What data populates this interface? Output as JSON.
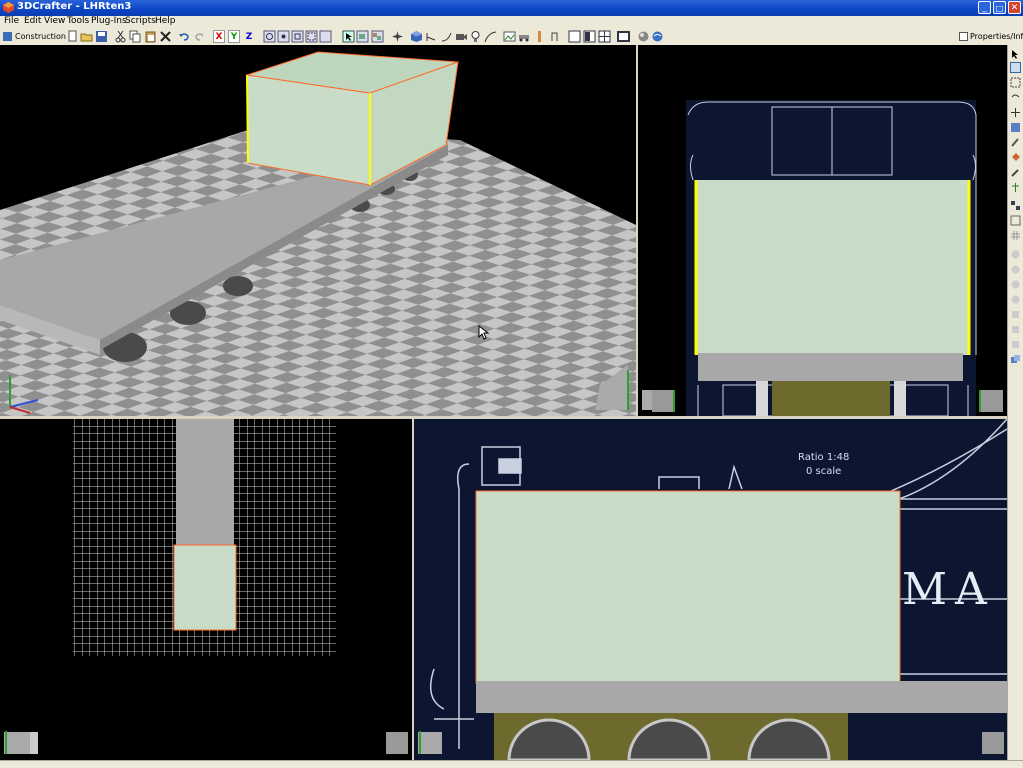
{
  "window": {
    "title": "3DCrafter - LHRten3",
    "minimize": "_",
    "maximize": "□",
    "close": "✕"
  },
  "menu": {
    "items": [
      "File",
      "Edit",
      "View",
      "Tools",
      "Plug-Ins",
      "Scripts",
      "Help"
    ]
  },
  "toolbar": {
    "construction_label": "Construction",
    "x_label": "X",
    "y_label": "Y",
    "z_label": "Z",
    "properties_label": "Properties/Info",
    "icons": [
      "new-icon",
      "open-icon",
      "save-icon",
      "cut-icon",
      "copy-icon",
      "paste-icon",
      "delete-icon",
      "undo-icon",
      "redo-icon"
    ]
  },
  "viewports": {
    "perspective": {
      "name": "perspective-view"
    },
    "front": {
      "name": "front-view"
    },
    "top": {
      "name": "top-view"
    },
    "side": {
      "name": "side-view",
      "ratio_line1": "Ratio 1:48",
      "ratio_line2": "0 scale",
      "lettering": "MA"
    }
  },
  "colors": {
    "model_face": "#c9dcc8",
    "selection_edge": "#ffff00",
    "titlebar": "#0b45c6",
    "chrome": "#ece9d8"
  }
}
